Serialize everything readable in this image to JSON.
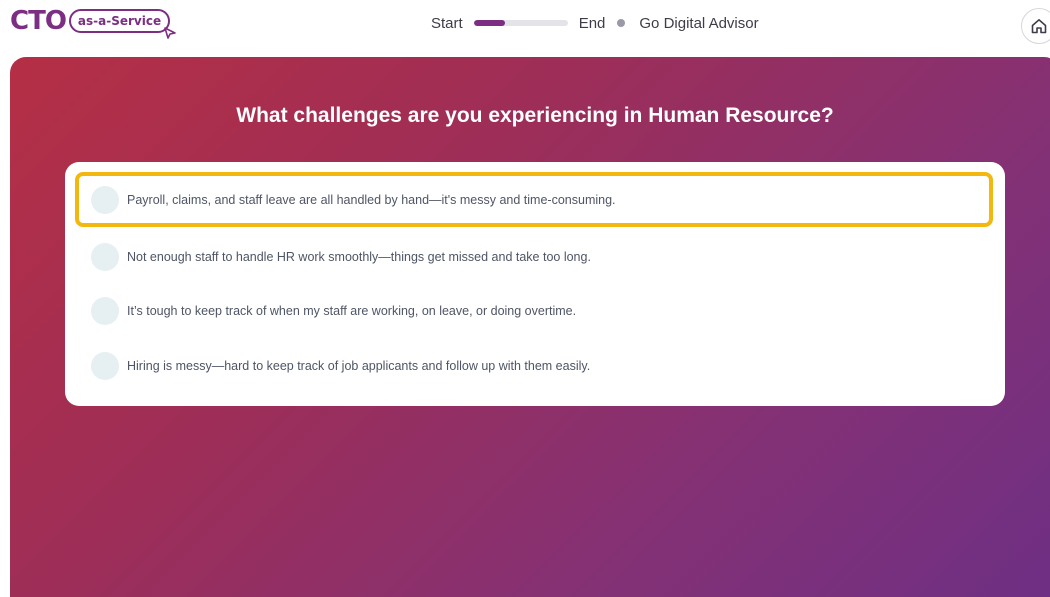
{
  "logo": {
    "main": "CTO",
    "pill": "as-a-Service"
  },
  "progress": {
    "start_label": "Start",
    "end_label": "End",
    "fraction": 0.33,
    "advisor_label": "Go Digital Advisor"
  },
  "home": {
    "icon": "home-icon"
  },
  "question": "What challenges are you experiencing in Human Resource?",
  "options": [
    {
      "label": "Payroll, claims, and staff leave are all handled by hand—it's messy and time-consuming.",
      "highlighted": true
    },
    {
      "label": "Not enough staff to handle HR work smoothly—things get missed and take too long.",
      "highlighted": false
    },
    {
      "label": "It’s tough to keep track of when my staff are working, on leave, or doing overtime.",
      "highlighted": false
    },
    {
      "label": "Hiring is messy—hard to keep track of job applicants and follow up with them easily.",
      "highlighted": false
    }
  ],
  "colors": {
    "brand": "#7b2e82",
    "highlight": "#f2b80f",
    "gradient_start": "#b52f45",
    "gradient_end": "#6e2f84"
  }
}
